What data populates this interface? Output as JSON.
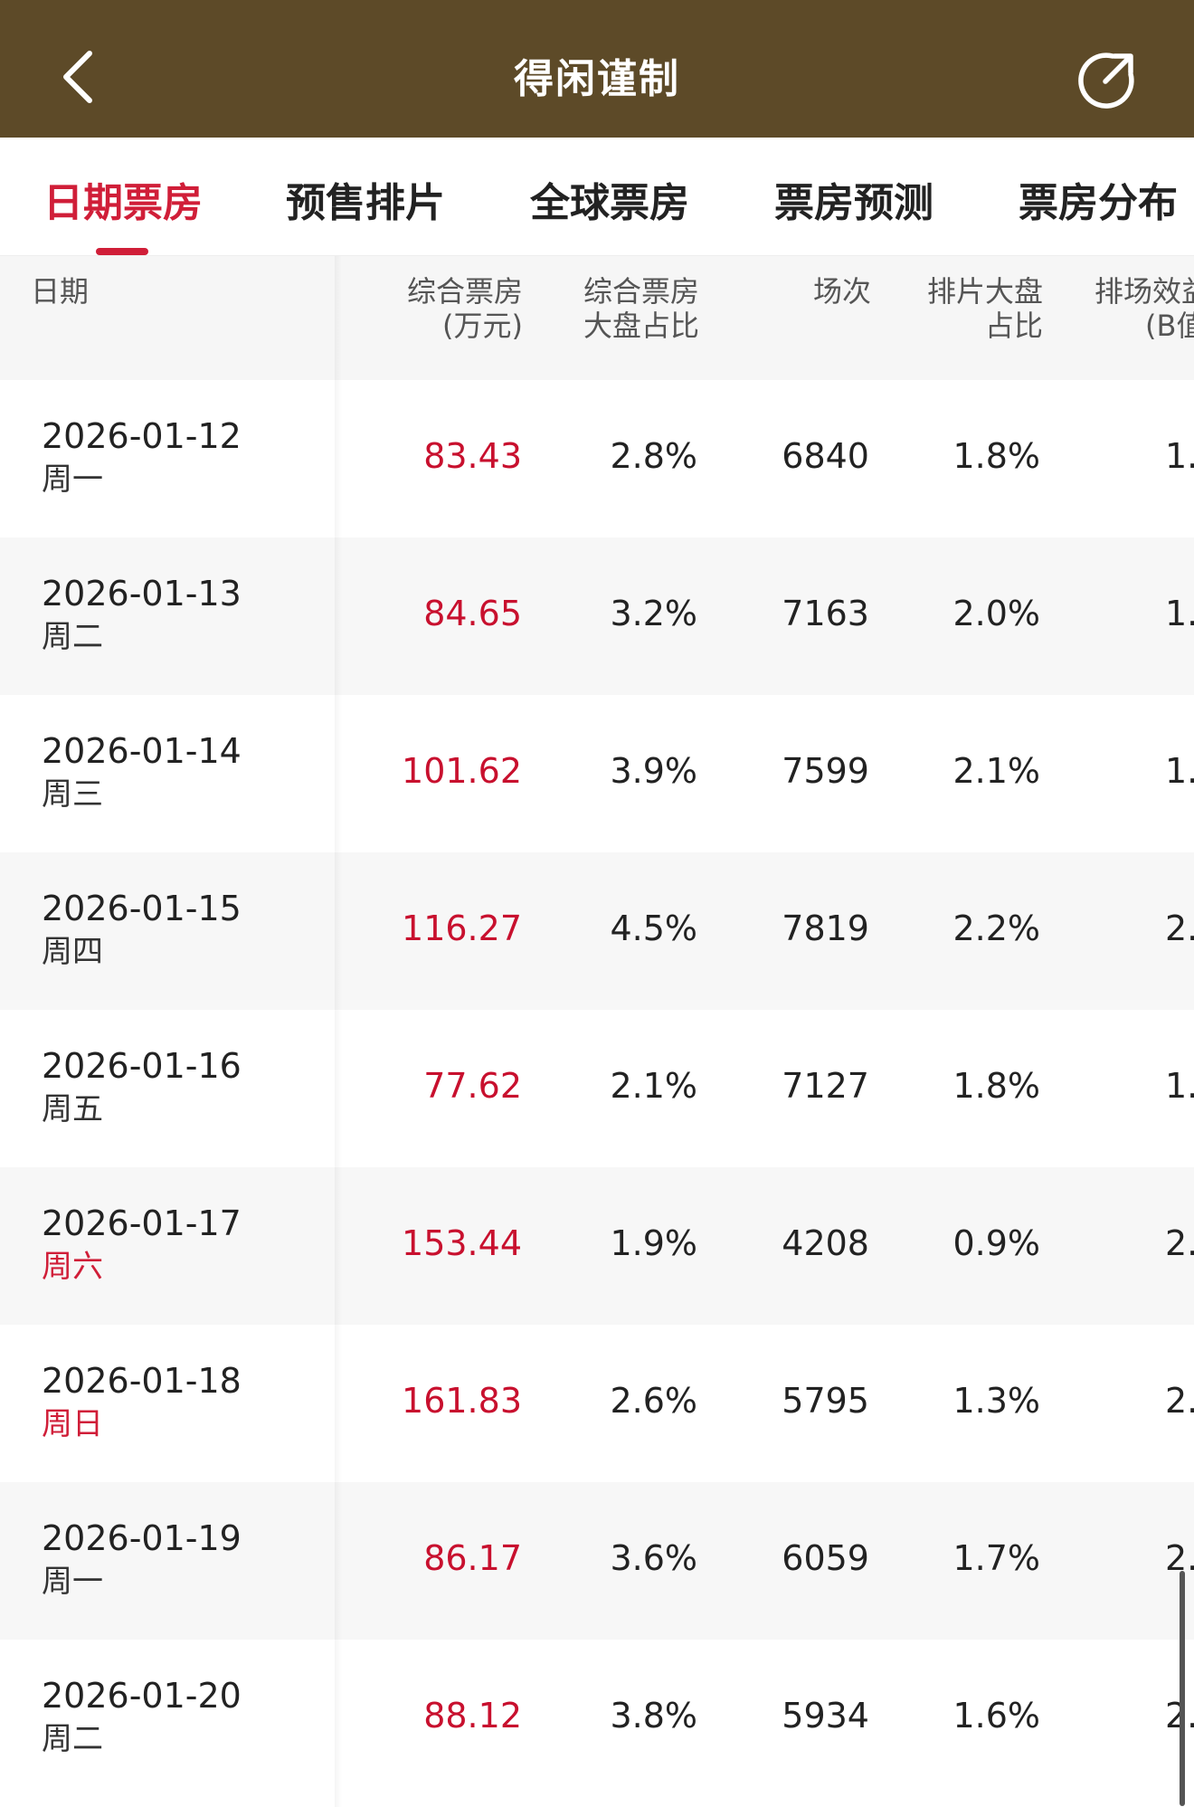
{
  "header": {
    "title": "得闲谨制",
    "back_icon": "chevron-left-icon",
    "share_icon": "share-icon",
    "background": "#5d4a28"
  },
  "tabs": [
    {
      "label": "日期票房",
      "active": true
    },
    {
      "label": "预售排片",
      "active": false
    },
    {
      "label": "全球票房",
      "active": false
    },
    {
      "label": "票房预测",
      "active": false
    },
    {
      "label": "票房分布",
      "active": false
    }
  ],
  "accent_color": "#d01e38",
  "table": {
    "headers": {
      "date": "日期",
      "boxoffice_line1": "综合票房",
      "boxoffice_line2": "(万元)",
      "share_line1": "综合票房",
      "share_line2": "大盘占比",
      "shows": "场次",
      "show_share_line1": "排片大盘",
      "show_share_line2": "占比",
      "efficiency_line1": "排场效益",
      "efficiency_line2": "(B值"
    },
    "rows": [
      {
        "date": "2026-01-12",
        "weekday": "周一",
        "weekend": false,
        "boxoffice": "83.43",
        "share": "2.8%",
        "shows": "6840",
        "show_share": "1.8%",
        "efficiency": "1."
      },
      {
        "date": "2026-01-13",
        "weekday": "周二",
        "weekend": false,
        "boxoffice": "84.65",
        "share": "3.2%",
        "shows": "7163",
        "show_share": "2.0%",
        "efficiency": "1."
      },
      {
        "date": "2026-01-14",
        "weekday": "周三",
        "weekend": false,
        "boxoffice": "101.62",
        "share": "3.9%",
        "shows": "7599",
        "show_share": "2.1%",
        "efficiency": "1."
      },
      {
        "date": "2026-01-15",
        "weekday": "周四",
        "weekend": false,
        "boxoffice": "116.27",
        "share": "4.5%",
        "shows": "7819",
        "show_share": "2.2%",
        "efficiency": "2."
      },
      {
        "date": "2026-01-16",
        "weekday": "周五",
        "weekend": false,
        "boxoffice": "77.62",
        "share": "2.1%",
        "shows": "7127",
        "show_share": "1.8%",
        "efficiency": "1."
      },
      {
        "date": "2026-01-17",
        "weekday": "周六",
        "weekend": true,
        "boxoffice": "153.44",
        "share": "1.9%",
        "shows": "4208",
        "show_share": "0.9%",
        "efficiency": "2."
      },
      {
        "date": "2026-01-18",
        "weekday": "周日",
        "weekend": true,
        "boxoffice": "161.83",
        "share": "2.6%",
        "shows": "5795",
        "show_share": "1.3%",
        "efficiency": "2."
      },
      {
        "date": "2026-01-19",
        "weekday": "周一",
        "weekend": false,
        "boxoffice": "86.17",
        "share": "3.6%",
        "shows": "6059",
        "show_share": "1.7%",
        "efficiency": "2."
      },
      {
        "date": "2026-01-20",
        "weekday": "周二",
        "weekend": false,
        "boxoffice": "88.12",
        "share": "3.8%",
        "shows": "5934",
        "show_share": "1.6%",
        "efficiency": "2."
      }
    ]
  }
}
